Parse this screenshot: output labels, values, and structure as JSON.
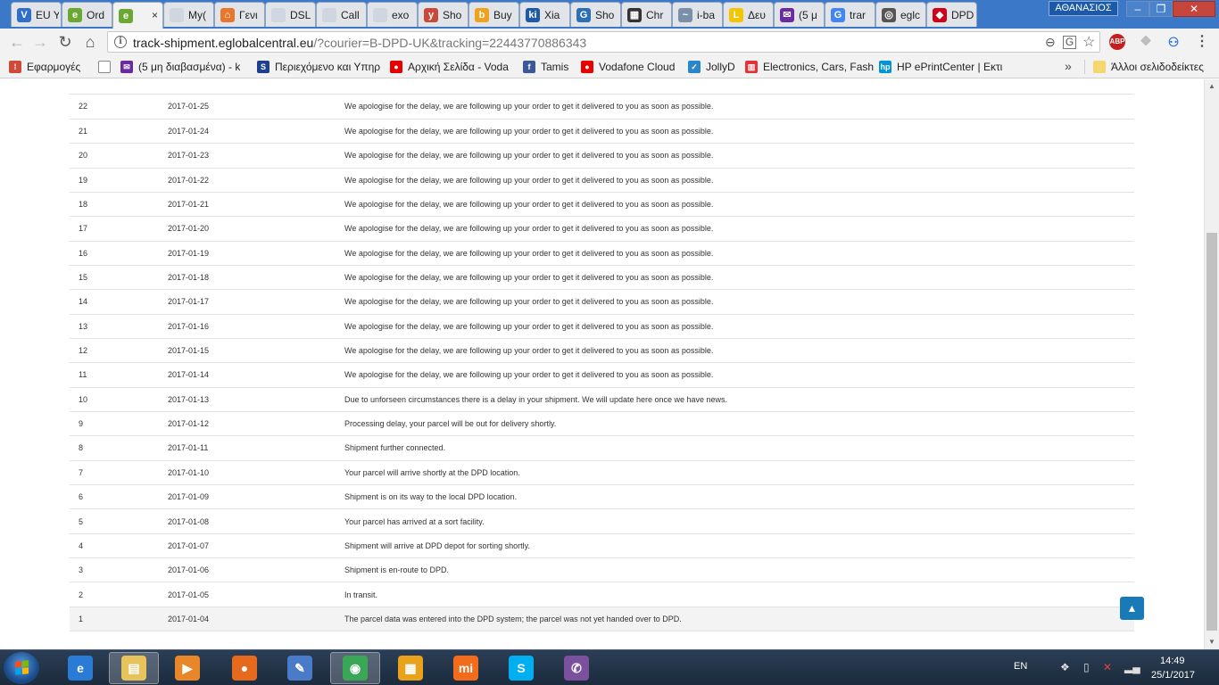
{
  "window": {
    "profile_name": "ΑΘΑΝΑΣΙΟΣ",
    "minimize_glyph": "–",
    "maximize_glyph": "❐",
    "close_glyph": "✕"
  },
  "tabs": [
    {
      "title": "EU Y",
      "icon_letter": "V",
      "icon_color": "#2f6fc9",
      "active": false
    },
    {
      "title": "Ord",
      "icon_letter": "e",
      "icon_color": "#6aa832",
      "active": false
    },
    {
      "title": "",
      "icon_letter": "e",
      "icon_color": "#6aa832",
      "active": true
    },
    {
      "title": "My(",
      "icon_letter": "",
      "icon_color": "#cfd6df",
      "active": false
    },
    {
      "title": "Γενι",
      "icon_letter": "⌂",
      "icon_color": "#e8772e",
      "active": false
    },
    {
      "title": "DSL",
      "icon_letter": "",
      "icon_color": "#cfd6df",
      "active": false
    },
    {
      "title": "Call",
      "icon_letter": "",
      "icon_color": "#cfd6df",
      "active": false
    },
    {
      "title": "exo",
      "icon_letter": "",
      "icon_color": "#cfd6df",
      "active": false
    },
    {
      "title": "Sho",
      "icon_letter": "y",
      "icon_color": "#c94a3a",
      "active": false
    },
    {
      "title": "Buy",
      "icon_letter": "b",
      "icon_color": "#f0a21c",
      "active": false
    },
    {
      "title": "Xia",
      "icon_letter": "ki",
      "icon_color": "#1e5aa8",
      "active": false
    },
    {
      "title": "Sho",
      "icon_letter": "G",
      "icon_color": "#2b6fb5",
      "active": false
    },
    {
      "title": "Chr",
      "icon_letter": "▦",
      "icon_color": "#333333",
      "active": false
    },
    {
      "title": "i-ba",
      "icon_letter": "~",
      "icon_color": "#7a8fa8",
      "active": false
    },
    {
      "title": "Δευ",
      "icon_letter": "L",
      "icon_color": "#f4c600",
      "active": false
    },
    {
      "title": "(5 μ",
      "icon_letter": "✉",
      "icon_color": "#6a2aa0",
      "active": false
    },
    {
      "title": "trar",
      "icon_letter": "G",
      "icon_color": "#4285f4",
      "active": false
    },
    {
      "title": "eglc",
      "icon_letter": "◎",
      "icon_color": "#555555",
      "active": false
    },
    {
      "title": "DPD",
      "icon_letter": "◆",
      "icon_color": "#d0021b",
      "active": false
    }
  ],
  "toolbar": {
    "back_glyph": "←",
    "forward_glyph": "→",
    "reload_glyph": "↻",
    "home_glyph": "⌂",
    "url_host": "track-shipment.eglobalcentral.eu",
    "url_path": "/?courier=B-DPD-UK&tracking=22443770886343",
    "info_glyph": "i",
    "zoom_glyph": "⊖",
    "translate_glyph": "G",
    "star_glyph": "☆",
    "abp_label": "ABP",
    "dropbox_glyph": "❖",
    "ext_glyph": "⚇",
    "menu_glyph": "⋮"
  },
  "bookmarks": [
    {
      "label": "Εφαρμογές",
      "icon_color": "#d04a3a",
      "icon_glyph": "⁞"
    },
    {
      "label": "",
      "icon_color": "#ffffff",
      "icon_glyph": ""
    },
    {
      "label": "(5 μη διαβασμένα) - k",
      "icon_color": "#6a2aa0",
      "icon_glyph": "✉"
    },
    {
      "label": "Περιεχόμενο και Υπηρ",
      "icon_color": "#1e3f8f",
      "icon_glyph": "S"
    },
    {
      "label": "Αρχική Σελίδα - Voda",
      "icon_color": "#e60000",
      "icon_glyph": "●"
    },
    {
      "label": "Tamis",
      "icon_color": "#3b5998",
      "icon_glyph": "f"
    },
    {
      "label": "Vodafone Cloud",
      "icon_color": "#e60000",
      "icon_glyph": "●"
    },
    {
      "label": "JollyD",
      "icon_color": "#2a86c8",
      "icon_glyph": "✓"
    },
    {
      "label": "Electronics, Cars, Fash",
      "icon_color": "#e53238",
      "icon_glyph": "▥"
    },
    {
      "label": "HP ePrintCenter | Εκτι",
      "icon_color": "#0096d6",
      "icon_glyph": "hp"
    }
  ],
  "bookmarks_more_glyph": "»",
  "other_bookmarks": {
    "label": "Άλλοι σελιδοδείκτες",
    "icon_color": "#f5d76e"
  },
  "tracking_rows": [
    {
      "num": "22",
      "date": "2017-01-25",
      "status": "We apologise for the delay, we are following up your order to get it delivered to you as soon as possible."
    },
    {
      "num": "21",
      "date": "2017-01-24",
      "status": "We apologise for the delay, we are following up your order to get it delivered to you as soon as possible."
    },
    {
      "num": "20",
      "date": "2017-01-23",
      "status": "We apologise for the delay, we are following up your order to get it delivered to you as soon as possible."
    },
    {
      "num": "19",
      "date": "2017-01-22",
      "status": "We apologise for the delay, we are following up your order to get it delivered to you as soon as possible."
    },
    {
      "num": "18",
      "date": "2017-01-21",
      "status": "We apologise for the delay, we are following up your order to get it delivered to you as soon as possible."
    },
    {
      "num": "17",
      "date": "2017-01-20",
      "status": "We apologise for the delay, we are following up your order to get it delivered to you as soon as possible."
    },
    {
      "num": "16",
      "date": "2017-01-19",
      "status": "We apologise for the delay, we are following up your order to get it delivered to you as soon as possible."
    },
    {
      "num": "15",
      "date": "2017-01-18",
      "status": "We apologise for the delay, we are following up your order to get it delivered to you as soon as possible."
    },
    {
      "num": "14",
      "date": "2017-01-17",
      "status": "We apologise for the delay, we are following up your order to get it delivered to you as soon as possible."
    },
    {
      "num": "13",
      "date": "2017-01-16",
      "status": "We apologise for the delay, we are following up your order to get it delivered to you as soon as possible."
    },
    {
      "num": "12",
      "date": "2017-01-15",
      "status": "We apologise for the delay, we are following up your order to get it delivered to you as soon as possible."
    },
    {
      "num": "11",
      "date": "2017-01-14",
      "status": "We apologise for the delay, we are following up your order to get it delivered to you as soon as possible."
    },
    {
      "num": "10",
      "date": "2017-01-13",
      "status": "Due to unforseen circumstances there is a delay in your shipment. We will update here once we have news."
    },
    {
      "num": "9",
      "date": "2017-01-12",
      "status": "Processing delay, your parcel will be out for delivery shortly."
    },
    {
      "num": "8",
      "date": "2017-01-11",
      "status": "Shipment further connected."
    },
    {
      "num": "7",
      "date": "2017-01-10",
      "status": "Your parcel will arrive shortly at the DPD location."
    },
    {
      "num": "6",
      "date": "2017-01-09",
      "status": "Shipment is on its way to the local DPD location."
    },
    {
      "num": "5",
      "date": "2017-01-08",
      "status": "Your parcel has arrived at a sort facility."
    },
    {
      "num": "4",
      "date": "2017-01-07",
      "status": "Shipment will arrive at DPD depot for sorting shortly."
    },
    {
      "num": "3",
      "date": "2017-01-06",
      "status": "Shipment is en-route to DPD."
    },
    {
      "num": "2",
      "date": "2017-01-05",
      "status": "In transit."
    },
    {
      "num": "1",
      "date": "2017-01-04",
      "status": "The parcel data was entered into the DPD system; the parcel was not yet handed over to DPD."
    }
  ],
  "scroll_top_glyph": "▲",
  "scrollbar": {
    "up_glyph": "▲",
    "down_glyph": "▼"
  },
  "taskbar": {
    "apps": [
      {
        "name": "internet-explorer",
        "glyph": "e",
        "color": "#2a7bd6",
        "active": false
      },
      {
        "name": "file-explorer",
        "glyph": "▤",
        "color": "#e8c25a",
        "active": true
      },
      {
        "name": "media-player",
        "glyph": "▶",
        "color": "#e8862a",
        "active": false
      },
      {
        "name": "firefox",
        "glyph": "●",
        "color": "#e66a1e",
        "active": false
      },
      {
        "name": "paint",
        "glyph": "✎",
        "color": "#4a7bc8",
        "active": false
      },
      {
        "name": "chrome",
        "glyph": "◉",
        "color": "#3aa757",
        "active": true
      },
      {
        "name": "windows-app",
        "glyph": "▦",
        "color": "#e8a21c",
        "active": false
      },
      {
        "name": "mi",
        "glyph": "mi",
        "color": "#f26c1c",
        "active": false
      },
      {
        "name": "skype",
        "glyph": "S",
        "color": "#00aff0",
        "active": false
      },
      {
        "name": "viber",
        "glyph": "✆",
        "color": "#7b519d",
        "active": false
      }
    ],
    "language": "EN",
    "time": "14:49",
    "date": "25/1/2017"
  }
}
